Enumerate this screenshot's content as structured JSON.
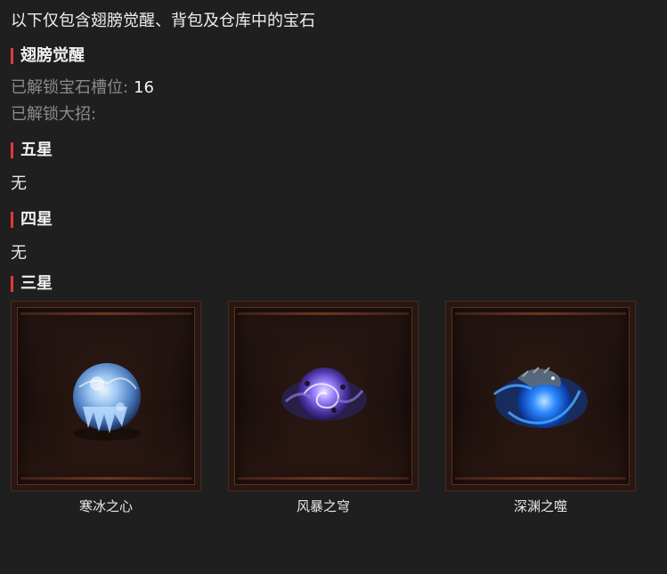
{
  "intro": "以下仅包含翅膀觉醒、背包及仓库中的宝石",
  "wing": {
    "title": "翅膀觉醒",
    "slots_label": "已解锁宝石槽位:",
    "slots_value": "16",
    "ultimate_label": "已解锁大招:"
  },
  "five_star": {
    "title": "五星",
    "content": "无"
  },
  "four_star": {
    "title": "四星",
    "content": "无"
  },
  "three_star": {
    "title": "三星",
    "gems": [
      {
        "name": "寒冰之心",
        "icon": "ice-heart-gem-icon"
      },
      {
        "name": "风暴之穹",
        "icon": "storm-dome-gem-icon"
      },
      {
        "name": "深渊之噬",
        "icon": "abyss-devour-gem-icon"
      }
    ]
  },
  "colors": {
    "accent": "#e1383c",
    "background": "#1f1f20"
  }
}
